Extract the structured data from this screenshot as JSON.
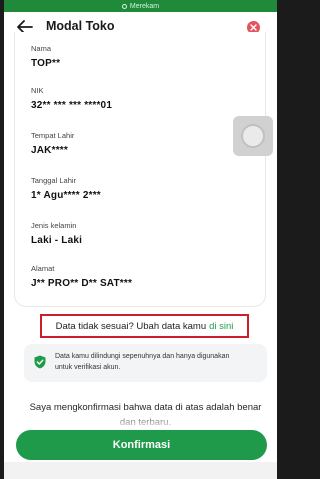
{
  "status_bar": {
    "recording_label": "Merekam"
  },
  "header": {
    "title": "Modal Toko",
    "back_icon": "arrow-left-icon",
    "close_icon": "close-icon"
  },
  "fields": [
    {
      "label": "Nama",
      "value": "TOP**"
    },
    {
      "label": "NIK",
      "value": "32** *** *** ****01"
    },
    {
      "label": "Tempat Lahir",
      "value": "JAK****"
    },
    {
      "label": "Tanggal Lahir",
      "value": "1* Agu**** 2***"
    },
    {
      "label": "Jenis kelamin",
      "value": "Laki - Laki"
    },
    {
      "label": "Alamat",
      "value": "J** PRO** D** SAT***"
    }
  ],
  "mismatch": {
    "text": "Data tidak sesuai? Ubah data kamu",
    "link": "di sini"
  },
  "notice": {
    "text": "Data kamu dilindungi sepenuhnya dan hanya digunakan untuk verifikasi akun.",
    "icon": "shield-check-icon"
  },
  "confirmation": {
    "text": "Saya mengkonfirmasi bahwa data di atas adalah benar dan terbaru."
  },
  "confirm_button": {
    "label": "Konfirmasi"
  },
  "colors": {
    "accent": "#1f9a4b",
    "highlight_border": "#cc1f2b",
    "close": "#e2545f"
  }
}
